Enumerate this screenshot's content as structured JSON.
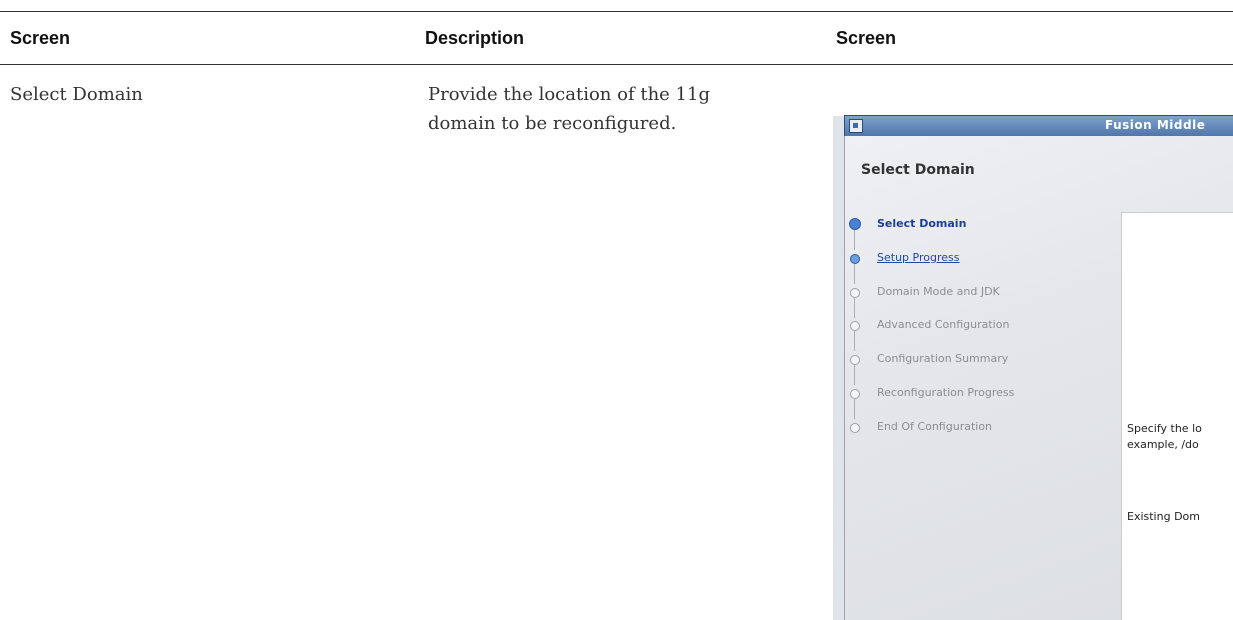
{
  "table": {
    "headers": [
      "Screen",
      "Description",
      "Screen"
    ],
    "row": {
      "screen": "Select Domain",
      "description": "Provide the location of the 11g domain to be reconfigured."
    }
  },
  "screenshot": {
    "window_title": "Fusion Middlе",
    "page_title": "Select Domain",
    "steps": [
      {
        "label": "Select Domain",
        "state": "active"
      },
      {
        "label": "Setup Progress",
        "state": "link"
      },
      {
        "label": "Domain Mode and JDK",
        "state": "disabled"
      },
      {
        "label": "Advanced Configuration",
        "state": "disabled"
      },
      {
        "label": "Configuration Summary",
        "state": "disabled"
      },
      {
        "label": "Reconfiguration Progress",
        "state": "disabled"
      },
      {
        "label": "End Of Configuration",
        "state": "disabled"
      }
    ],
    "panel": {
      "specify_line1": "Specify the lo",
      "specify_line2": "example, /do",
      "existing_domain": "Existing Dom"
    }
  }
}
